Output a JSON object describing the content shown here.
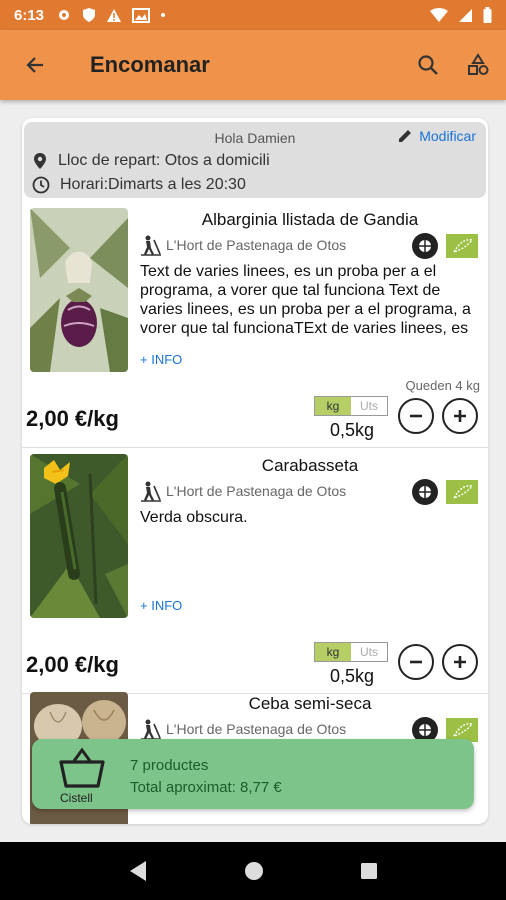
{
  "status_bar": {
    "time": "6:13"
  },
  "app_bar": {
    "title": "Encomanar"
  },
  "user": {
    "greeting": "Hola Damien",
    "edit_label": "Modificar",
    "delivery_place": "Lloc de repart: Otos a domicili",
    "schedule": "Horari:Dimarts a les 20:30"
  },
  "products": [
    {
      "name": "Albarginia llistada de Gandia",
      "producer": "L'Hort de Pastenaga de Otos",
      "description": "Text de varies linees, es un proba per a el programa, a vorer que tal funciona Text de varies linees, es un proba per a el programa, a vorer que tal funcionaTExt de varies linees, es un proba per a el programa",
      "info_label": "+ INFO",
      "remaining": "Queden 4 kg",
      "price": "2,00 €/kg",
      "unit_kg": "kg",
      "unit_uts": "Uts",
      "quantity": "0,5kg"
    },
    {
      "name": "Carabasseta",
      "producer": "L'Hort de Pastenaga de Otos",
      "description": "Verda obscura.",
      "info_label": "+ INFO",
      "price": "2,00 €/kg",
      "unit_kg": "kg",
      "unit_uts": "Uts",
      "quantity": "0,5kg"
    },
    {
      "name": "Ceba semi-seca",
      "producer": "L'Hort de Pastenaga de Otos"
    }
  ],
  "basket": {
    "label": "Cistell",
    "count": "7 productes",
    "total": "Total aproximat: 8,77 €"
  },
  "colors": {
    "status_bar": "#e07a30",
    "app_bar": "#f0934a",
    "basket": "#7dc48a",
    "link": "#1a73d9",
    "unit_selected": "#b5cf66"
  }
}
